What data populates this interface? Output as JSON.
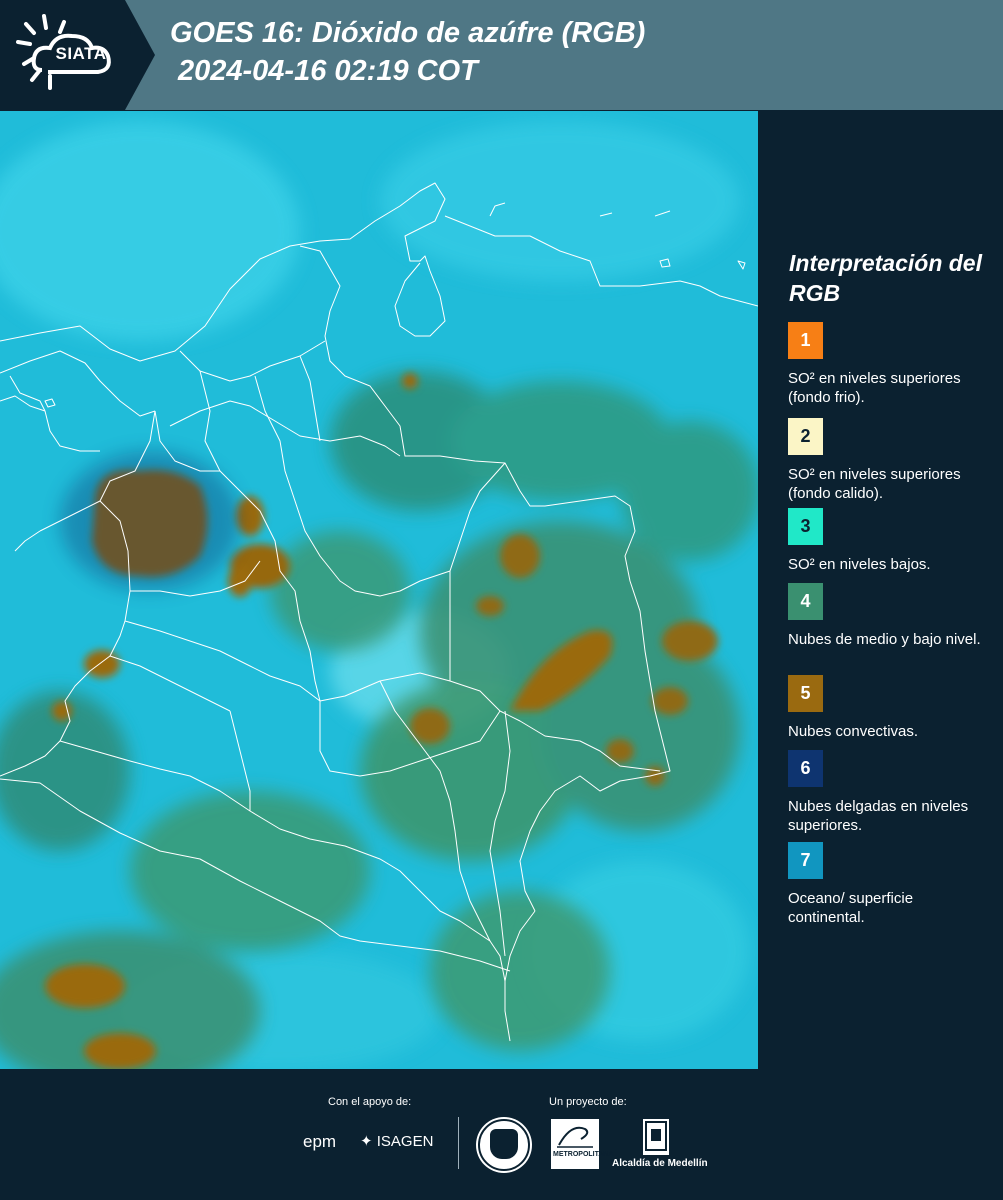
{
  "header": {
    "logo_text": "SIATA",
    "title_line1": "GOES 16: Dióxido de azúfre (RGB)",
    "title_line2": "2024-04-16 02:19 COT",
    "background_color": "#4f7785"
  },
  "legend": {
    "title": "Interpretación del RGB",
    "items": [
      {
        "number": "1",
        "color": "#f77f15",
        "description": "SO² en niveles superiores (fondo frio)."
      },
      {
        "number": "2",
        "color": "#fbf5c6",
        "description": "SO² en niveles superiores (fondo calido)."
      },
      {
        "number": "3",
        "color": "#20e8c8",
        "description": "SO² en niveles bajos."
      },
      {
        "number": "4",
        "color": "#3a9070",
        "description": "Nubes de medio y bajo nivel."
      },
      {
        "number": "5",
        "color": "#9a6a10",
        "description": "Nubes convectivas."
      },
      {
        "number": "6",
        "color": "#0e3470",
        "description": "Nubes delgadas en niveles superiores."
      },
      {
        "number": "7",
        "color": "#1196c0",
        "description": "Oceano/ superficie continental."
      }
    ]
  },
  "map": {
    "background_color": "#20bcd9",
    "border_color": "#ffffff"
  },
  "footer": {
    "support_label": "Con el apoyo de:",
    "project_label": "Un proyecto de:",
    "sponsors": [
      "epm",
      "ISAGEN"
    ],
    "partners": [
      "Área Metropolitana Valle de Aburrá",
      "Alcaldía de Medellín"
    ],
    "area_logo_text": "METROPOLITANA",
    "alcaldia_text": "Alcaldía de Medellín"
  }
}
